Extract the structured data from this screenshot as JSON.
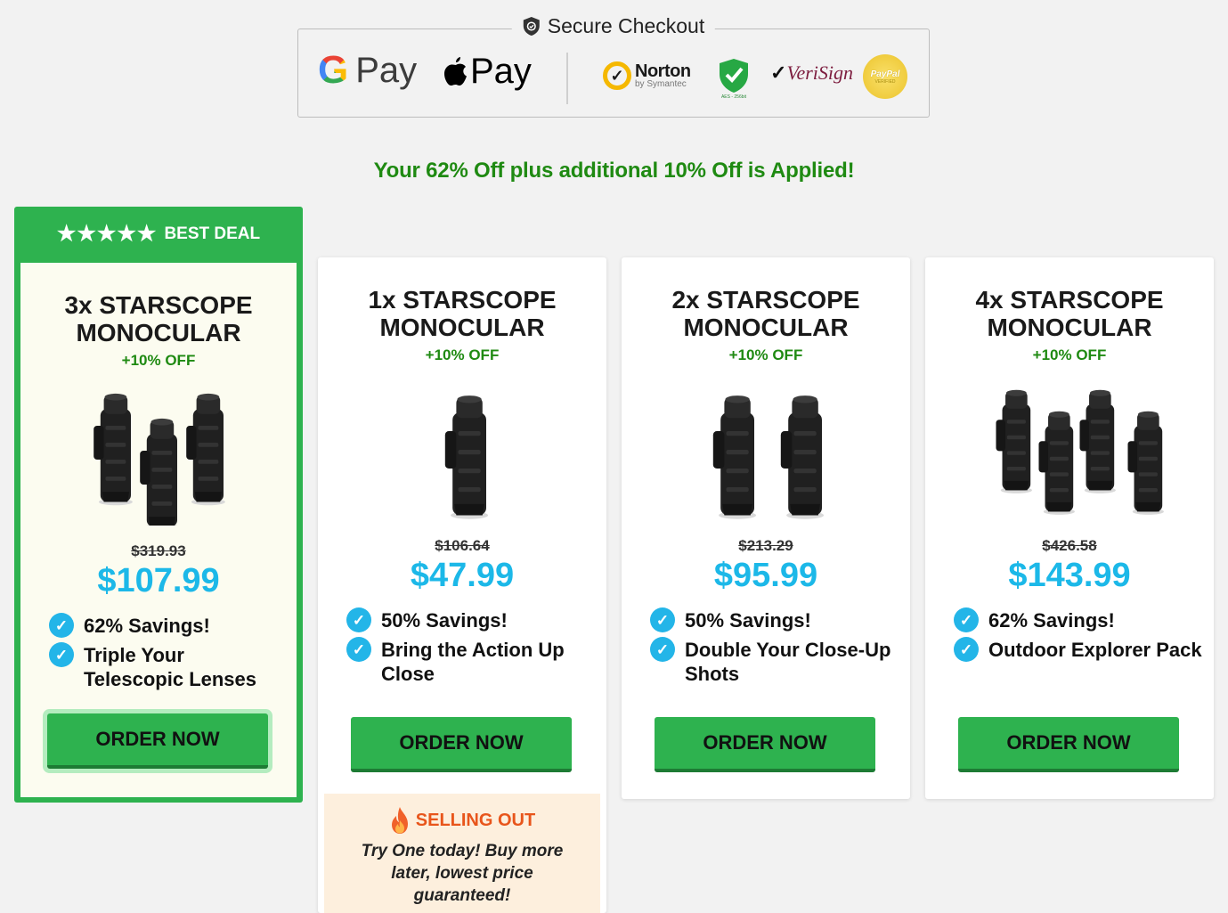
{
  "checkout": {
    "title": "Secure Checkout",
    "gpay_label": "Pay",
    "apay_label": "Pay",
    "norton_name": "Norton",
    "norton_sub": "by Symantec",
    "aes_label": "AES - 256bit",
    "verisign_label": "VeriSign",
    "paypal_label": "PayPal",
    "paypal_sub": "VERIFIED"
  },
  "promo_text": "Your 62% Off plus additional 10% Off is Applied!",
  "best_deal": {
    "stars": "★★★★★",
    "label": "BEST DEAL"
  },
  "products": [
    {
      "title_line1": "3x STARSCOPE",
      "title_line2": "MONOCULAR",
      "extra_off": "+10% OFF",
      "quantity": 3,
      "old_price": "$319.93",
      "price": "$107.99",
      "features": [
        "62% Savings!",
        "Triple Your Telescopic Lenses"
      ],
      "cta": "ORDER NOW"
    },
    {
      "title_line1": "1x STARSCOPE",
      "title_line2": "MONOCULAR",
      "extra_off": "+10% OFF",
      "quantity": 1,
      "old_price": "$106.64",
      "price": "$47.99",
      "features": [
        "50% Savings!",
        "Bring the Action Up Close"
      ],
      "cta": "ORDER NOW"
    },
    {
      "title_line1": "2x STARSCOPE",
      "title_line2": "MONOCULAR",
      "extra_off": "+10% OFF",
      "quantity": 2,
      "old_price": "$213.29",
      "price": "$95.99",
      "features": [
        "50% Savings!",
        "Double Your Close-Up Shots"
      ],
      "cta": "ORDER NOW"
    },
    {
      "title_line1": "4x STARSCOPE",
      "title_line2": "MONOCULAR",
      "extra_off": "+10% OFF",
      "quantity": 4,
      "old_price": "$426.58",
      "price": "$143.99",
      "features": [
        "62% Savings!",
        "Outdoor Explorer Pack"
      ],
      "cta": "ORDER NOW"
    }
  ],
  "selling_out": {
    "heading": "SELLING OUT",
    "message": "Try One today! Buy more later, lowest price guaranteed!"
  },
  "colors": {
    "brand_green": "#2eb24f",
    "price_blue": "#1cb8e8",
    "promo_green": "#1f8a12",
    "selling_orange": "#e8551b"
  }
}
